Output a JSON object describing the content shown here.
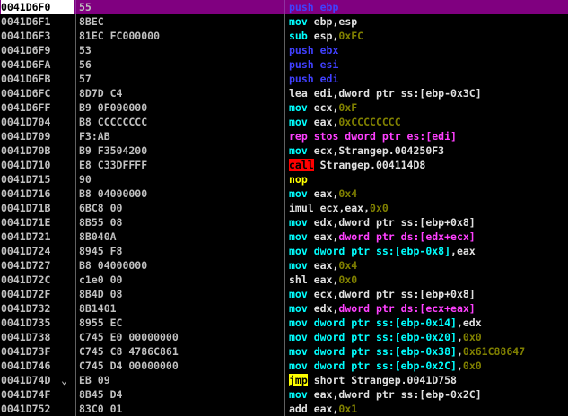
{
  "colors": {
    "background": "#000000",
    "selection": "#800080",
    "push_pop": "#4040ff",
    "mov_family": "#00ffff",
    "immediate": "#808000",
    "rep_mem": "#ff40ff",
    "call_bg": "#ff0000",
    "jmp_bg": "#ffff00"
  },
  "rows": [
    {
      "addr": "0041D6F0",
      "bytes": "55",
      "selected": true,
      "dis": [
        {
          "t": "push",
          "c": "c-push"
        },
        {
          "t": " ebp",
          "c": "c-push"
        }
      ]
    },
    {
      "addr": "0041D6F1",
      "bytes": "8BEC",
      "dis": [
        {
          "t": "mov ",
          "c": "c-mov"
        },
        {
          "t": "ebp,esp",
          "c": "c-white"
        }
      ]
    },
    {
      "addr": "0041D6F3",
      "bytes": "81EC FC000000",
      "dis": [
        {
          "t": "sub ",
          "c": "c-mov"
        },
        {
          "t": "esp,",
          "c": "c-white"
        },
        {
          "t": "0xFC",
          "c": "c-num"
        }
      ]
    },
    {
      "addr": "0041D6F9",
      "bytes": "53",
      "dis": [
        {
          "t": "push ebx",
          "c": "c-push"
        }
      ]
    },
    {
      "addr": "0041D6FA",
      "bytes": "56",
      "dis": [
        {
          "t": "push esi",
          "c": "c-push"
        }
      ]
    },
    {
      "addr": "0041D6FB",
      "bytes": "57",
      "dis": [
        {
          "t": "push edi",
          "c": "c-push"
        }
      ]
    },
    {
      "addr": "0041D6FC",
      "bytes": "8D7D C4",
      "dis": [
        {
          "t": "lea ",
          "c": "c-white"
        },
        {
          "t": "edi,dword ptr ss:[ebp-0x3C]",
          "c": "c-white"
        }
      ]
    },
    {
      "addr": "0041D6FF",
      "bytes": "B9 0F000000",
      "dis": [
        {
          "t": "mov ",
          "c": "c-mov"
        },
        {
          "t": "ecx,",
          "c": "c-white"
        },
        {
          "t": "0xF",
          "c": "c-num"
        }
      ]
    },
    {
      "addr": "0041D704",
      "bytes": "B8 CCCCCCCC",
      "dis": [
        {
          "t": "mov ",
          "c": "c-mov"
        },
        {
          "t": "eax,",
          "c": "c-white"
        },
        {
          "t": "0xCCCCCCCC",
          "c": "c-num"
        }
      ]
    },
    {
      "addr": "0041D709",
      "bytes": "F3:AB",
      "dis": [
        {
          "t": "rep stos dword ptr es:[edi]",
          "c": "c-rep"
        }
      ]
    },
    {
      "addr": "0041D70B",
      "bytes": "B9 F3504200",
      "dis": [
        {
          "t": "mov ",
          "c": "c-mov"
        },
        {
          "t": "ecx,Strangep.004250F3",
          "c": "c-white"
        }
      ]
    },
    {
      "addr": "0041D710",
      "bytes": "E8 C33DFFFF",
      "dis": [
        {
          "t": "call",
          "c": "c-call"
        },
        {
          "t": " Strangep.004114D8",
          "c": "c-white"
        }
      ]
    },
    {
      "addr": "0041D715",
      "bytes": "90",
      "dis": [
        {
          "t": "nop",
          "c": "c-yellow"
        }
      ]
    },
    {
      "addr": "0041D716",
      "bytes": "B8 04000000",
      "dis": [
        {
          "t": "mov ",
          "c": "c-mov"
        },
        {
          "t": "eax,",
          "c": "c-white"
        },
        {
          "t": "0x4",
          "c": "c-num"
        }
      ]
    },
    {
      "addr": "0041D71B",
      "bytes": "6BC8 00",
      "dis": [
        {
          "t": "imul ",
          "c": "c-white"
        },
        {
          "t": "ecx,eax,",
          "c": "c-white"
        },
        {
          "t": "0x0",
          "c": "c-num"
        }
      ]
    },
    {
      "addr": "0041D71E",
      "bytes": "8B55 08",
      "dis": [
        {
          "t": "mov ",
          "c": "c-mov"
        },
        {
          "t": "edx,dword ptr ss:[ebp+0x8]",
          "c": "c-white"
        }
      ]
    },
    {
      "addr": "0041D721",
      "bytes": "8B040A",
      "dis": [
        {
          "t": "mov ",
          "c": "c-mov"
        },
        {
          "t": "eax,",
          "c": "c-white"
        },
        {
          "t": "dword ptr ds:[edx+ecx]",
          "c": "c-rep"
        }
      ]
    },
    {
      "addr": "0041D724",
      "bytes": "8945 F8",
      "dis": [
        {
          "t": "mov ",
          "c": "c-mov"
        },
        {
          "t": "dword ptr ss:[ebp-0x8]",
          "c": "c-mov"
        },
        {
          "t": ",eax",
          "c": "c-white"
        }
      ]
    },
    {
      "addr": "0041D727",
      "bytes": "B8 04000000",
      "dis": [
        {
          "t": "mov ",
          "c": "c-mov"
        },
        {
          "t": "eax,",
          "c": "c-white"
        },
        {
          "t": "0x4",
          "c": "c-num"
        }
      ]
    },
    {
      "addr": "0041D72C",
      "bytes": "c1e0 00",
      "dis": [
        {
          "t": "shl ",
          "c": "c-white"
        },
        {
          "t": "eax,",
          "c": "c-white"
        },
        {
          "t": "0x0",
          "c": "c-num"
        }
      ]
    },
    {
      "addr": "0041D72F",
      "bytes": "8B4D 08",
      "dis": [
        {
          "t": "mov ",
          "c": "c-mov"
        },
        {
          "t": "ecx,dword ptr ss:[ebp+0x8]",
          "c": "c-white"
        }
      ]
    },
    {
      "addr": "0041D732",
      "bytes": "8B1401",
      "dis": [
        {
          "t": "mov ",
          "c": "c-mov"
        },
        {
          "t": "edx,",
          "c": "c-white"
        },
        {
          "t": "dword ptr ds:[ecx+eax]",
          "c": "c-rep"
        }
      ]
    },
    {
      "addr": "0041D735",
      "bytes": "8955 EC",
      "dis": [
        {
          "t": "mov ",
          "c": "c-mov"
        },
        {
          "t": "dword ptr ss:[ebp-0x14]",
          "c": "c-mov"
        },
        {
          "t": ",edx",
          "c": "c-white"
        }
      ]
    },
    {
      "addr": "0041D738",
      "bytes": "C745 E0 00000000",
      "dis": [
        {
          "t": "mov ",
          "c": "c-mov"
        },
        {
          "t": "dword ptr ss:[ebp-0x20]",
          "c": "c-mov"
        },
        {
          "t": ",",
          "c": "c-white"
        },
        {
          "t": "0x0",
          "c": "c-num"
        }
      ]
    },
    {
      "addr": "0041D73F",
      "bytes": "C745 C8 4786C861",
      "dis": [
        {
          "t": "mov ",
          "c": "c-mov"
        },
        {
          "t": "dword ptr ss:[ebp-0x38]",
          "c": "c-mov"
        },
        {
          "t": ",",
          "c": "c-white"
        },
        {
          "t": "0x61C88647",
          "c": "c-num"
        }
      ]
    },
    {
      "addr": "0041D746",
      "bytes": "C745 D4 00000000",
      "dis": [
        {
          "t": "mov ",
          "c": "c-mov"
        },
        {
          "t": "dword ptr ss:[ebp-0x2C]",
          "c": "c-mov"
        },
        {
          "t": ",",
          "c": "c-white"
        },
        {
          "t": "0x0",
          "c": "c-num"
        }
      ]
    },
    {
      "addr": "0041D74D",
      "bytes": "EB 09",
      "marker": "⌄",
      "dis": [
        {
          "t": "jmp",
          "c": "c-jmp"
        },
        {
          "t": " short Strangep.0041D758",
          "c": "c-white"
        }
      ]
    },
    {
      "addr": "0041D74F",
      "bytes": "8B45 D4",
      "dis": [
        {
          "t": "mov ",
          "c": "c-mov"
        },
        {
          "t": "eax,dword ptr ss:[ebp-0x2C]",
          "c": "c-white"
        }
      ]
    },
    {
      "addr": "0041D752",
      "bytes": "83C0 01",
      "dis": [
        {
          "t": "add ",
          "c": "c-white"
        },
        {
          "t": "eax,",
          "c": "c-white"
        },
        {
          "t": "0x1",
          "c": "c-num"
        }
      ]
    }
  ]
}
